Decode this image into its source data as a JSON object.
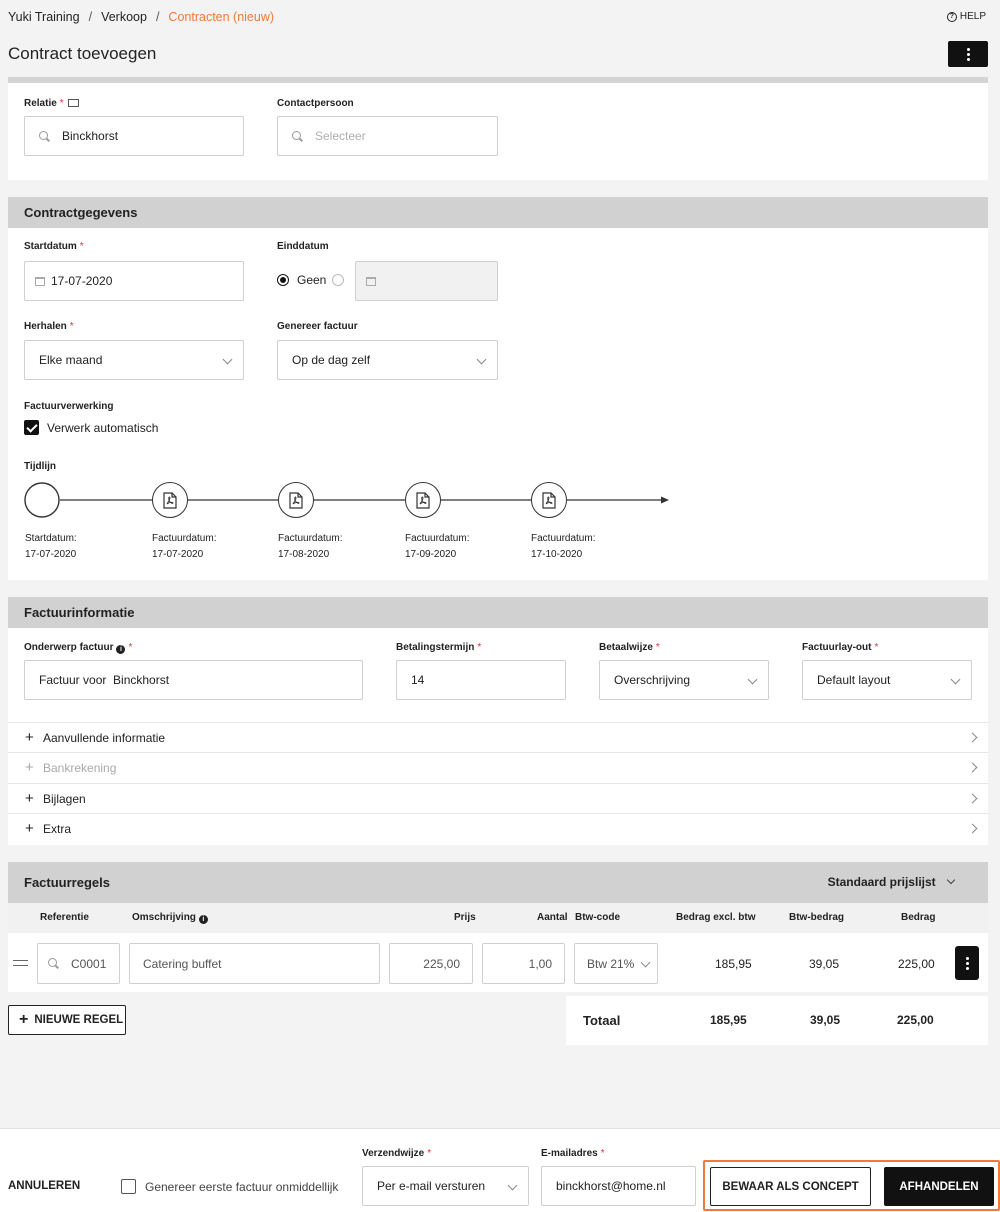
{
  "breadcrumb": [
    "Yuki Training",
    "Verkoop",
    "Contracten (nieuw)"
  ],
  "help_label": "HELP",
  "page_title": "Contract toevoegen",
  "relatie": {
    "label": "Relatie",
    "value": "Binckhorst"
  },
  "contactpersoon": {
    "label": "Contactpersoon",
    "placeholder": "Selecteer"
  },
  "contract": {
    "title": "Contractgegevens",
    "startdatum_label": "Startdatum",
    "startdatum_value": "17-07-2020",
    "einddatum_label": "Einddatum",
    "einddatum_option": "Geen",
    "herhalen_label": "Herhalen",
    "herhalen_value": "Elke maand",
    "genereer_label": "Genereer factuur",
    "genereer_value": "Op de dag zelf",
    "verwerking_label": "Factuurverwerking",
    "verwerking_option": "Verwerk automatisch",
    "tijdlijn_label": "Tijdlijn",
    "timeline": [
      {
        "label": "Startdatum:",
        "date": "17-07-2020"
      },
      {
        "label": "Factuurdatum:",
        "date": "17-07-2020"
      },
      {
        "label": "Factuurdatum:",
        "date": "17-08-2020"
      },
      {
        "label": "Factuurdatum:",
        "date": "17-09-2020"
      },
      {
        "label": "Factuurdatum:",
        "date": "17-10-2020"
      }
    ]
  },
  "factuurinfo": {
    "title": "Factuurinformatie",
    "onderwerp_label": "Onderwerp factuur",
    "onderwerp_value": "Factuur voor  Binckhorst",
    "termijn_label": "Betalingstermijn",
    "termijn_value": "14",
    "betaalwijze_label": "Betaalwijze",
    "betaalwijze_value": "Overschrijving",
    "layout_label": "Factuurlay-out",
    "layout_value": "Default layout",
    "sections": [
      "Aanvullende informatie",
      "Bankrekening",
      "Bijlagen",
      "Extra"
    ]
  },
  "regels": {
    "title": "Factuurregels",
    "prijslijst": "Standaard prijslijst",
    "columns": [
      "Referentie",
      "Omschrijving",
      "Prijs",
      "Aantal",
      "Btw-code",
      "Bedrag excl. btw",
      "Btw-bedrag",
      "Bedrag"
    ],
    "row": {
      "referentie": "C0001",
      "omschrijving": "Catering buffet",
      "prijs": "225,00",
      "aantal": "1,00",
      "btw_code": "Btw 21%",
      "excl": "185,95",
      "btw": "39,05",
      "bedrag": "225,00"
    },
    "nieuwe_regel": "NIEUWE REGEL",
    "totaal_label": "Totaal",
    "totaal_excl": "185,95",
    "totaal_btw": "39,05",
    "totaal_bedrag": "225,00"
  },
  "footer": {
    "annuleren": "ANNULEREN",
    "genereer_direct": "Genereer eerste factuur onmiddellijk",
    "verzendwijze_label": "Verzendwijze",
    "verzendwijze_value": "Per e-mail versturen",
    "email_label": "E-mailadres",
    "email_value": "binckhorst@home.nl",
    "bewaar": "BEWAAR ALS CONCEPT",
    "afhandelen": "AFHANDELEN"
  },
  "colors": {
    "accent": "#f07a3a",
    "required": "#e0303a",
    "dark": "#111111"
  }
}
